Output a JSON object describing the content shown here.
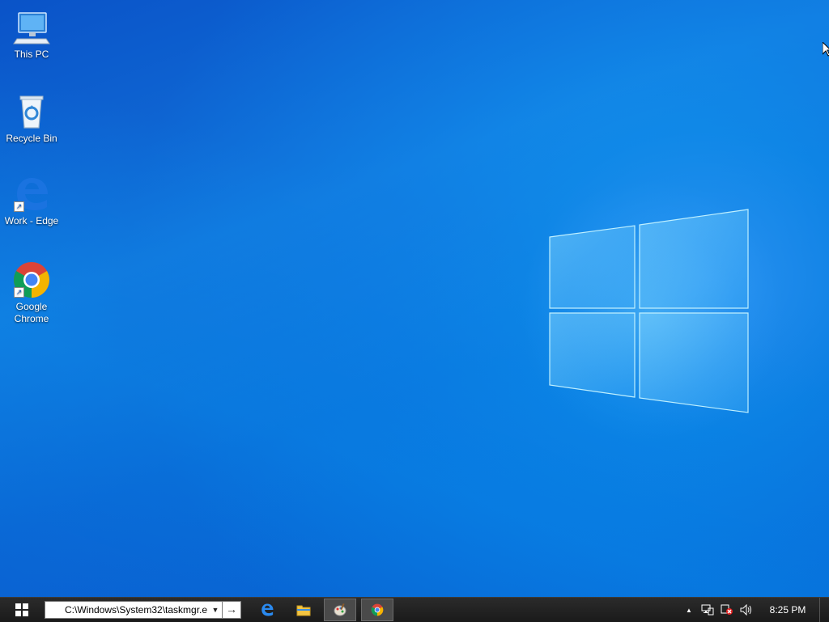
{
  "desktop": {
    "icons": [
      {
        "label": "This PC",
        "icon": "computer-icon",
        "shortcut": false
      },
      {
        "label": "Recycle Bin",
        "icon": "recycle-bin-icon",
        "shortcut": false
      },
      {
        "label": "Work - Edge",
        "icon": "edge-icon",
        "shortcut": true
      },
      {
        "label": "Google Chrome",
        "icon": "chrome-icon",
        "shortcut": true
      }
    ],
    "wallpaper": "windows-10-hero"
  },
  "taskbar": {
    "address_value": "C:\\Windows\\System32\\taskmgr.e",
    "go_glyph": "→",
    "drop_glyph": "▼",
    "apps": [
      {
        "name": "Microsoft Edge",
        "icon": "edge-icon",
        "active": false
      },
      {
        "name": "File Explorer",
        "icon": "folder-icon",
        "active": false
      },
      {
        "name": "Paint",
        "icon": "paint-icon",
        "active": true
      },
      {
        "name": "Google Chrome",
        "icon": "chrome-icon",
        "active": true
      }
    ],
    "tray": {
      "chevron": "▲",
      "icons": [
        "network-icon",
        "notification-error-icon",
        "volume-icon"
      ]
    },
    "clock": "8:25 PM"
  },
  "colors": {
    "accent": "#0a78d7",
    "taskbar": "#1f1f1f"
  }
}
